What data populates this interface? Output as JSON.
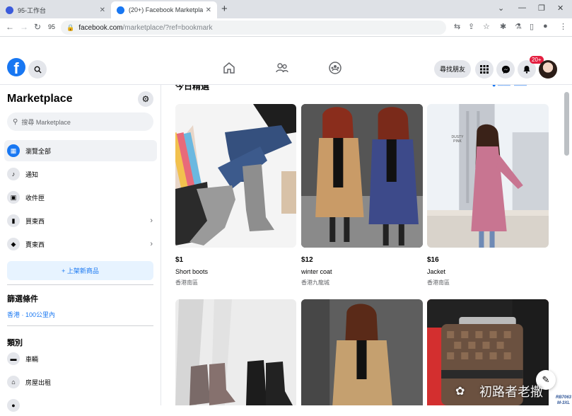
{
  "browser": {
    "tabs": [
      {
        "label": "95-工作台",
        "active": false
      },
      {
        "label": "(20+) Facebook Marketplace | Fa",
        "active": true
      }
    ],
    "profile_number": "95",
    "url_host": "facebook.com",
    "url_path": "/marketplace/?ref=bookmark"
  },
  "header": {
    "find_friends": "尋找朋友",
    "notification_count": "20+"
  },
  "sidebar": {
    "title": "Marketplace",
    "search_placeholder": "搜尋 Marketplace",
    "items": [
      {
        "label": "瀏覽全部",
        "icon": "storefront-icon",
        "active": true
      },
      {
        "label": "通知",
        "icon": "bell-icon"
      },
      {
        "label": "收件匣",
        "icon": "inbox-icon"
      },
      {
        "label": "買東西",
        "icon": "shopping-bag-icon",
        "chevron": true
      },
      {
        "label": "賣東西",
        "icon": "tag-icon",
        "chevron": true
      }
    ],
    "create_listing": "+ 上架新商品",
    "filters_heading": "篩選條件",
    "location": "香港 · 100公里內",
    "categories_heading": "類別",
    "categories": [
      {
        "label": "車輛",
        "icon": "car-icon"
      },
      {
        "label": "房屋出租",
        "icon": "house-icon"
      }
    ]
  },
  "main": {
    "section_title": "今日精選",
    "listings": [
      {
        "price": "$1",
        "name": "Short boots",
        "location": "香港南區"
      },
      {
        "price": "$12",
        "name": "winter coat",
        "location": "香港九龍城"
      },
      {
        "price": "$16",
        "name": "Jacket",
        "location": "香港南區"
      }
    ],
    "photo_label": "RB7063\nM-3XL\nKhaki",
    "photo_sign": "DUSTY PINK"
  },
  "watermark": "初路者老撒"
}
